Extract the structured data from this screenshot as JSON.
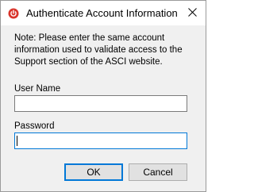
{
  "window": {
    "title": "Authenticate Account Information",
    "app_icon": "red-power-icon",
    "close_icon": "close-icon"
  },
  "dialog": {
    "note": "Note: Please enter the same account\ninformation used to validate access to the\nSupport section of the ASCI website.",
    "username": {
      "label": "User Name",
      "value": ""
    },
    "password": {
      "label": "Password",
      "value": ""
    },
    "buttons": {
      "ok_label": "OK",
      "cancel_label": "Cancel"
    }
  },
  "colors": {
    "accent": "#0078d7",
    "app_icon": "#d9342b",
    "dialog_background": "#f0f0f0"
  }
}
